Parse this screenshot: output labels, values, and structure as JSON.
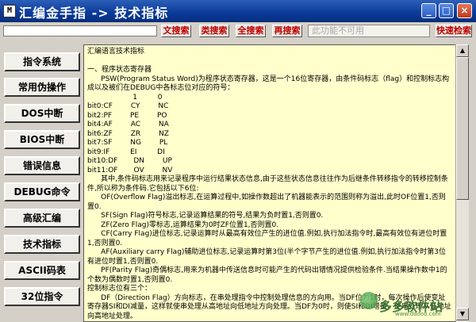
{
  "window": {
    "title": "汇编金手指 -> 技术指标",
    "icon_label": "M",
    "controls": {
      "minimize": "_",
      "maximize": "□",
      "close": "×"
    }
  },
  "toolbar": {
    "search_value": "",
    "buttons": [
      {
        "label": "文搜索",
        "name": "text-search-button"
      },
      {
        "label": "类搜索",
        "name": "category-search-button"
      },
      {
        "label": "全搜索",
        "name": "full-search-button"
      },
      {
        "label": "再搜索",
        "name": "search-again-button"
      }
    ],
    "disabled_field": "此功能不可用",
    "quick_search": "快速检索"
  },
  "sidebar": {
    "items": [
      "指令系统",
      "常用伪操作",
      "DOS中断",
      "BIOS中断",
      "错误信息",
      "DEBUG命令",
      "高级汇编",
      "技术指标",
      "ASCII码表",
      "32位指令"
    ]
  },
  "content": {
    "text": "汇编语言技术指标\n\n一、程序状态寄存器\n      PSW(Program Status Word)为程序状态寄存器，这是一个16位寄存器，由条件码标志（flag）和控制标志构成以及被们在DEBUG中各标志位对应的符号：\n                    1         0\nbit0:CF        CY        NC\nbit2:PF        PE        PO\nbit4:AF        AC        NA\nbit6:ZF        ZR        NZ\nbit7:SF        NG        PL\nbit9:IF         EI         DI\nbit10:DF       DN        UP\nbit11:OF       OV        NV\n      其中,条件码标志用来记录程序中运行结果状态信息,由于这些状态信息往往作为后继条件转移指令的转移控制条件,所以称为条件码.它包括以下6位:\n      OF(Overflow Flag)溢出标志,在运算过程中,如操作数超出了机器能表示的范围则称为溢出,此时OF位置1,否则置0.\n      SF(Sign Flag)符号标志,记录运算结果的符号,结果为负时置1,否则置0.\n      ZF(Zero Flag)零标志,运算结果为0时ZF位置1,否则置0.\n      CF(Carry Flag)进位标志,记录运算时从最高有效位产生的进位值.例如,执行加法指令时,最高有效位有进位时置1,否则置0.\n      AF(Auxiliary carry Flag)辅助进位标志,记录运算时第3位(半个字节产生的进位值.例如,执行加法指令时第3位有进位时置1,否则置0.\n      PF(Parity Flag)奇偶标志,用来为机器中传送信息时可能产生的代码出错情况提供检验条件.当结果操作数中1的个数为偶数时置1,否则置0.\n控制标志位有三个：\n      DF（Direction Flag）方向标志，在串处理指令中控制处理信息的方向用。当DF位为1时，每次操作后使变址寄存器SI和DI减量，这样就使串处理从高地址向低地址方向处理。当DF为0时，则使SI和DI增量，使串处理从低地址向高地址处理。"
  },
  "watermark": {
    "text": "多多软件站",
    "sub": "www.ddooo.com"
  }
}
